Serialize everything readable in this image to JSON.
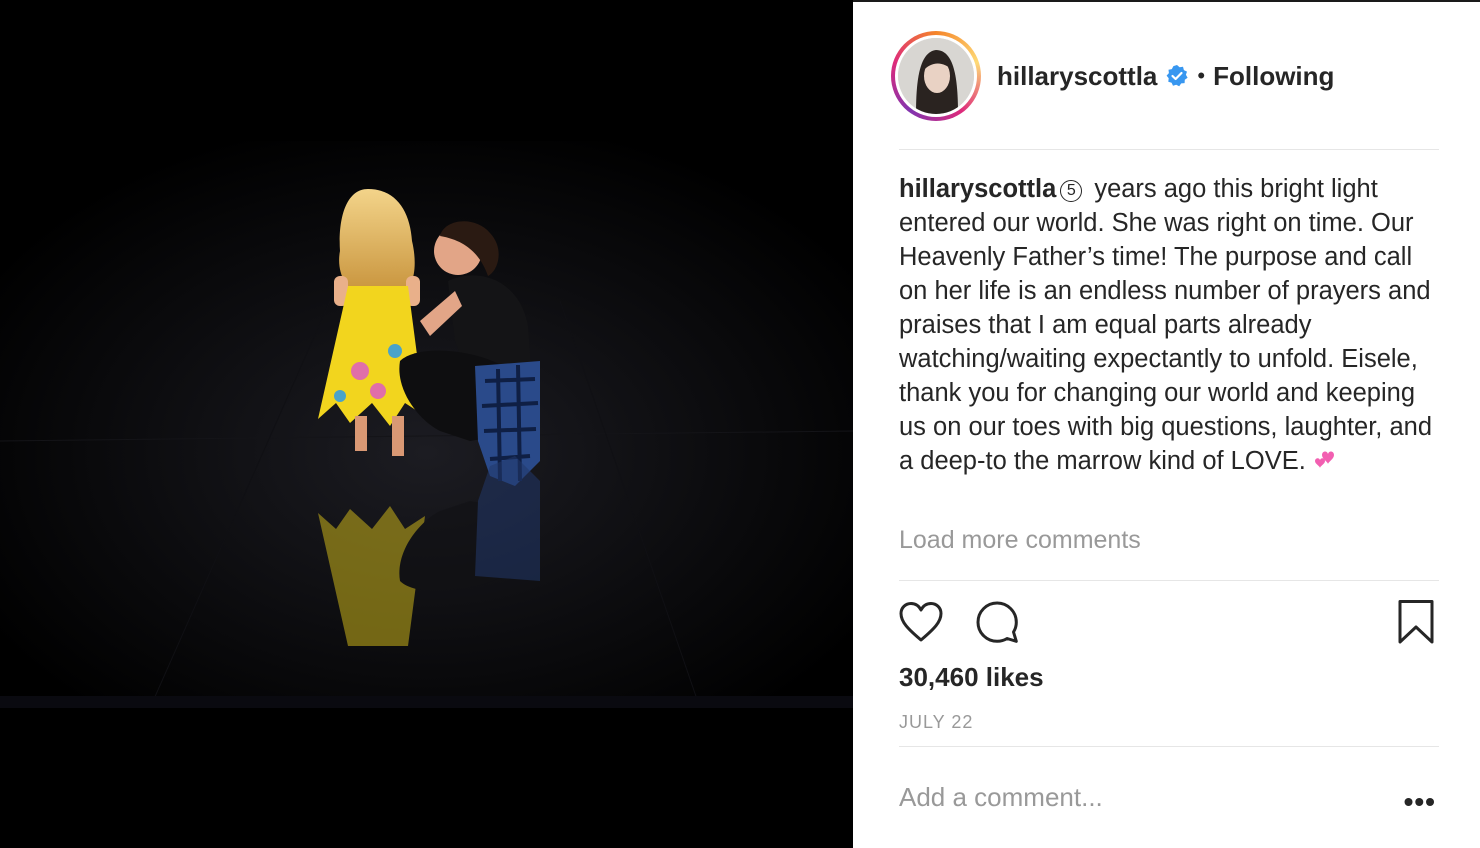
{
  "post": {
    "username": "hillaryscottla",
    "separator": "•",
    "follow_status": "Following",
    "caption": {
      "username": "hillaryscottla",
      "number_glyph": "5",
      "text": "years ago this bright light entered our world. She was right on time. Our Heavenly Father’s time! The purpose and call on her life is an endless number of prayers and praises that I am equal parts already watching/waiting expectantly to unfold. Eisele, thank you for changing our world and keeping us on our toes with big questions, laughter, and a deep-to the marrow kind of LOVE."
    },
    "load_more": "Load more comments",
    "likes": "30,460 likes",
    "date": "JULY 22",
    "comment_placeholder": "Add a comment...",
    "more_options": "•••"
  },
  "icons": {
    "verified": "verified-badge-icon",
    "like": "heart-icon",
    "comment": "comment-icon",
    "save": "bookmark-icon",
    "emoji": "two-hearts-emoji"
  },
  "colors": {
    "verified_blue": "#3897f0",
    "text": "#262626",
    "muted": "#999999",
    "divider": "#e6e6e6",
    "emoji_pink": "#f25fb1"
  }
}
